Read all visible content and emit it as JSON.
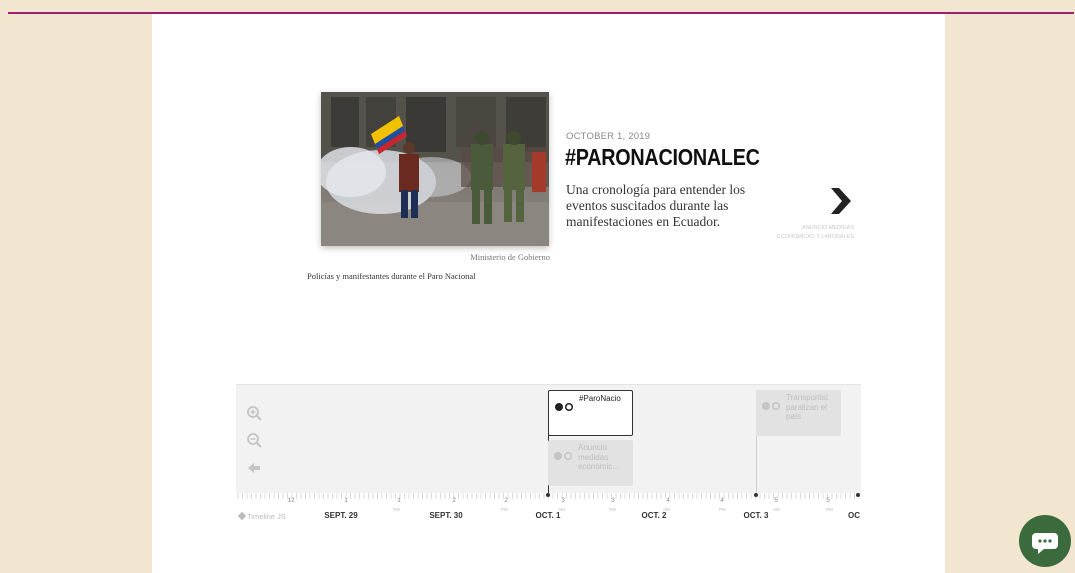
{
  "slide": {
    "photo_credit": "Ministerio de Gobierno",
    "photo_caption": "Policías y manifestantes durante el Paro Nacional",
    "date": "OCTOBER 1, 2019",
    "title": "#PARONACIONALEC",
    "description": "Una cronología para entender los eventos suscitados durante las manifestaciones en Ecuador.",
    "next_label": "ANUNCIO MEDIDAS ECONÓMICAS Y LABORALES"
  },
  "timeline": {
    "markers": [
      {
        "text": "#ParoNacio",
        "active": true
      },
      {
        "text": "Anuncio medidas económic...",
        "active": false
      },
      {
        "text": "Transportist paralizan el país",
        "active": false
      }
    ],
    "axis": {
      "major": [
        "SEPT. 29",
        "SEPT. 30",
        "OCT. 1",
        "OCT. 2",
        "OCT. 3",
        "OC"
      ],
      "minor": [
        "12",
        "1",
        "1",
        "2",
        "2",
        "3",
        "3",
        "4",
        "4",
        "5",
        "5"
      ],
      "pm_label": "PM",
      "am_label": "AM"
    },
    "brand": "Timeline JS"
  },
  "icons": {
    "zoom_in": "zoom-in-icon",
    "zoom_out": "zoom-out-icon",
    "back": "back-arrow-icon",
    "next": "chevron-right-icon",
    "chat": "chat-bubble-icon"
  },
  "colors": {
    "accent_line": "#9b1f6e",
    "page_bg": "#f2e6d0",
    "chat_bg": "#3b6b3c"
  }
}
